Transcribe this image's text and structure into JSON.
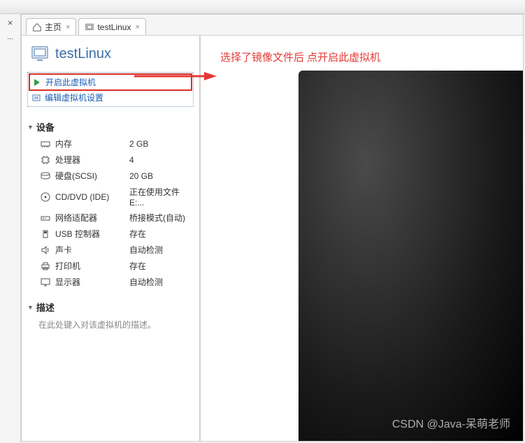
{
  "tabs": [
    {
      "label": "主页",
      "icon": "home"
    },
    {
      "label": "testLinux",
      "icon": "vm"
    }
  ],
  "vm": {
    "title": "testLinux",
    "actions": {
      "power_on": "开启此虚拟机",
      "edit_settings": "编辑虚拟机设置"
    }
  },
  "sections": {
    "devices": {
      "title": "设备",
      "items": [
        {
          "icon": "memory",
          "label": "内存",
          "value": "2 GB"
        },
        {
          "icon": "cpu",
          "label": "处理器",
          "value": "4"
        },
        {
          "icon": "hdd",
          "label": "硬盘(SCSI)",
          "value": "20 GB"
        },
        {
          "icon": "cd",
          "label": "CD/DVD (IDE)",
          "value": "正在使用文件 E:..."
        },
        {
          "icon": "network",
          "label": "网络适配器",
          "value": "桥接模式(自动)"
        },
        {
          "icon": "usb",
          "label": "USB 控制器",
          "value": "存在"
        },
        {
          "icon": "sound",
          "label": "声卡",
          "value": "自动检测"
        },
        {
          "icon": "printer",
          "label": "打印机",
          "value": "存在"
        },
        {
          "icon": "display",
          "label": "显示器",
          "value": "自动检测"
        }
      ]
    },
    "description": {
      "title": "描述",
      "placeholder": "在此处键入对该虚拟机的描述。"
    }
  },
  "annotation": "选择了镜像文件后 点开启此虚拟机",
  "watermark": "CSDN @Java-呆萌老师",
  "left_strip": {
    "dots": "..."
  }
}
